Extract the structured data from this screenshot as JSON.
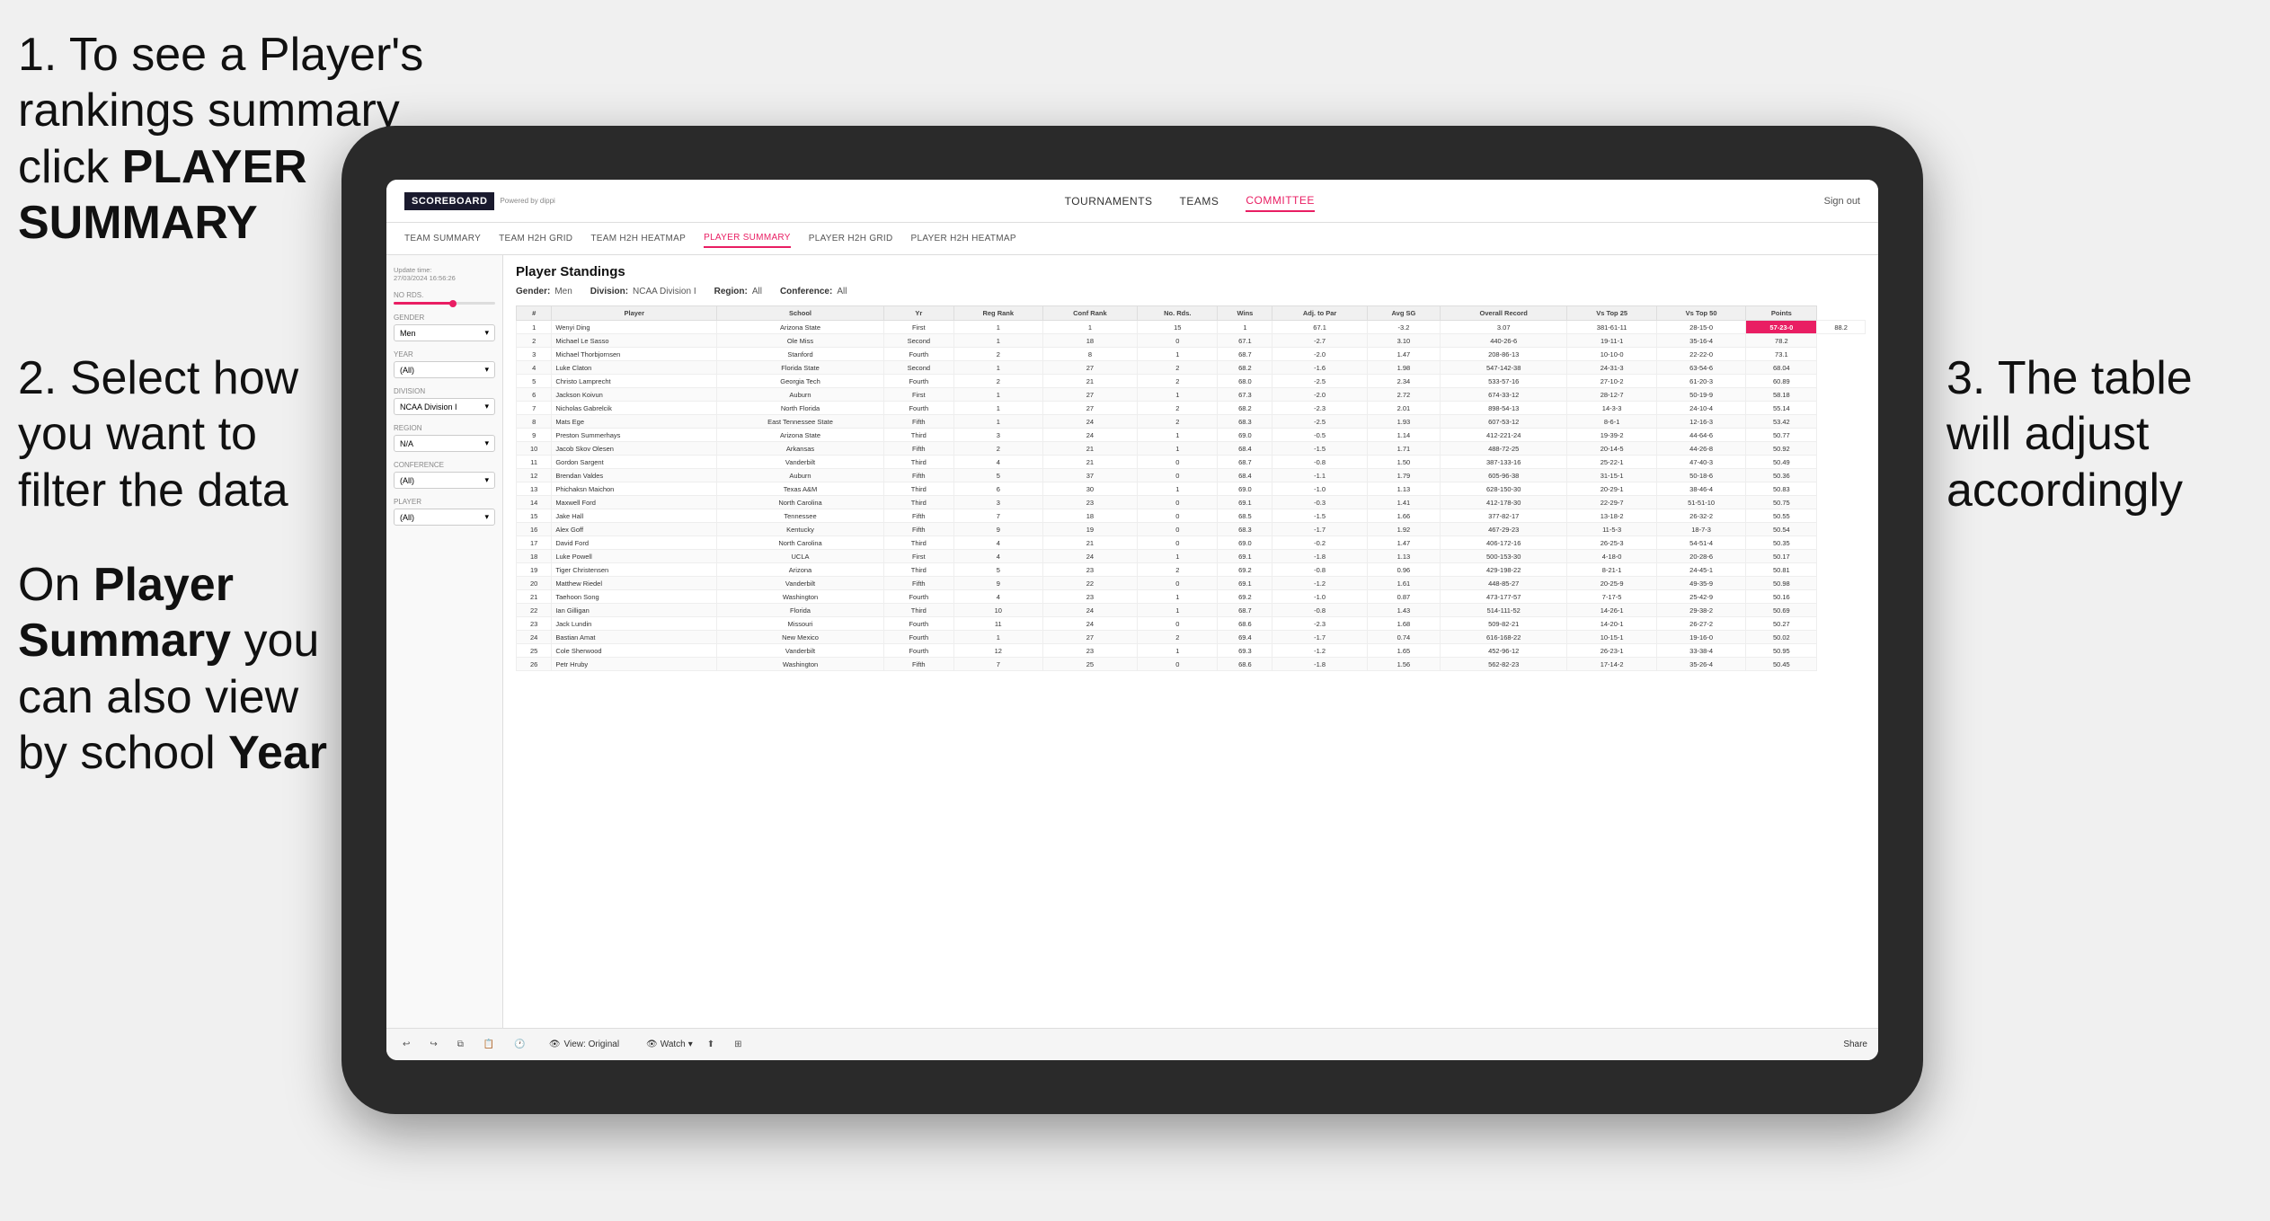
{
  "instructions": {
    "step1": "1. To see a Player's rankings summary click ",
    "step1_bold": "PLAYER SUMMARY",
    "step2_title": "2. Select how you want to filter the data",
    "step3_title": "3. The table will adjust accordingly",
    "bottom_note": "On ",
    "bottom_bold1": "Player Summary",
    "bottom_mid": " you can also view by school ",
    "bottom_bold2": "Year"
  },
  "app": {
    "logo": "SCOREBOARD",
    "logo_sub": "Powered by dippi",
    "sign_out": "Sign out"
  },
  "nav": {
    "items": [
      "TOURNAMENTS",
      "TEAMS",
      "COMMITTEE"
    ],
    "active": "COMMITTEE"
  },
  "subnav": {
    "items": [
      "TEAM SUMMARY",
      "TEAM H2H GRID",
      "TEAM H2H HEATMAP",
      "PLAYER SUMMARY",
      "PLAYER H2H GRID",
      "PLAYER H2H HEATMAP"
    ],
    "active": "PLAYER SUMMARY"
  },
  "sidebar": {
    "update_label": "Update time:",
    "update_time": "27/03/2024 16:56:26",
    "no_rds_label": "No Rds.",
    "gender_label": "Gender",
    "gender_value": "Men",
    "year_label": "Year",
    "year_value": "(All)",
    "division_label": "Division",
    "division_value": "NCAA Division I",
    "region_label": "Region",
    "region_value": "N/A",
    "conference_label": "Conference",
    "conference_value": "(All)",
    "player_label": "Player",
    "player_value": "(All)"
  },
  "table": {
    "title": "Player Standings",
    "gender": "Men",
    "division": "NCAA Division I",
    "region": "All",
    "conference": "All",
    "columns": [
      "#",
      "Player",
      "School",
      "Yr",
      "Reg Rank",
      "Conf Rank",
      "No. Rds.",
      "Wins",
      "Adj. to Par",
      "Avg SG",
      "Overall Record",
      "Vs Top 25",
      "Vs Top 50",
      "Points"
    ],
    "rows": [
      [
        "1",
        "Wenyi Ding",
        "Arizona State",
        "First",
        "1",
        "1",
        "15",
        "1",
        "67.1",
        "-3.2",
        "3.07",
        "381-61-11",
        "28-15-0",
        "57-23-0",
        "88.2"
      ],
      [
        "2",
        "Michael Le Sasso",
        "Ole Miss",
        "Second",
        "1",
        "18",
        "0",
        "67.1",
        "-2.7",
        "3.10",
        "440-26-6",
        "19-11-1",
        "35-16-4",
        "78.2"
      ],
      [
        "3",
        "Michael Thorbjornsen",
        "Stanford",
        "Fourth",
        "2",
        "8",
        "1",
        "68.7",
        "-2.0",
        "1.47",
        "208-86-13",
        "10-10-0",
        "22-22-0",
        "73.1"
      ],
      [
        "4",
        "Luke Claton",
        "Florida State",
        "Second",
        "1",
        "27",
        "2",
        "68.2",
        "-1.6",
        "1.98",
        "547-142-38",
        "24-31-3",
        "63-54-6",
        "68.04"
      ],
      [
        "5",
        "Christo Lamprecht",
        "Georgia Tech",
        "Fourth",
        "2",
        "21",
        "2",
        "68.0",
        "-2.5",
        "2.34",
        "533-57-16",
        "27-10-2",
        "61-20-3",
        "60.89"
      ],
      [
        "6",
        "Jackson Koivun",
        "Auburn",
        "First",
        "1",
        "27",
        "1",
        "67.3",
        "-2.0",
        "2.72",
        "674-33-12",
        "28-12-7",
        "50-19-9",
        "58.18"
      ],
      [
        "7",
        "Nicholas Gabrelcik",
        "North Florida",
        "Fourth",
        "1",
        "27",
        "2",
        "68.2",
        "-2.3",
        "2.01",
        "898-54-13",
        "14-3-3",
        "24-10-4",
        "55.14"
      ],
      [
        "8",
        "Mats Ege",
        "East Tennessee State",
        "Fifth",
        "1",
        "24",
        "2",
        "68.3",
        "-2.5",
        "1.93",
        "607-53-12",
        "8-6-1",
        "12-16-3",
        "53.42"
      ],
      [
        "9",
        "Preston Summerhays",
        "Arizona State",
        "Third",
        "3",
        "24",
        "1",
        "69.0",
        "-0.5",
        "1.14",
        "412-221-24",
        "19-39-2",
        "44-64-6",
        "50.77"
      ],
      [
        "10",
        "Jacob Skov Olesen",
        "Arkansas",
        "Fifth",
        "2",
        "21",
        "1",
        "68.4",
        "-1.5",
        "1.71",
        "488-72-25",
        "20-14-5",
        "44-26-8",
        "50.92"
      ],
      [
        "11",
        "Gordon Sargent",
        "Vanderbilt",
        "Third",
        "4",
        "21",
        "0",
        "68.7",
        "-0.8",
        "1.50",
        "387-133-16",
        "25-22-1",
        "47-40-3",
        "50.49"
      ],
      [
        "12",
        "Brendan Valdes",
        "Auburn",
        "Fifth",
        "5",
        "37",
        "0",
        "68.4",
        "-1.1",
        "1.79",
        "605-96-38",
        "31-15-1",
        "50-18-6",
        "50.36"
      ],
      [
        "13",
        "Phichaksn Maichon",
        "Texas A&M",
        "Third",
        "6",
        "30",
        "1",
        "69.0",
        "-1.0",
        "1.13",
        "628-150-30",
        "20-29-1",
        "38-46-4",
        "50.83"
      ],
      [
        "14",
        "Maxwell Ford",
        "North Carolina",
        "Third",
        "3",
        "23",
        "0",
        "69.1",
        "-0.3",
        "1.41",
        "412-178-30",
        "22-29-7",
        "51-51-10",
        "50.75"
      ],
      [
        "15",
        "Jake Hall",
        "Tennessee",
        "Fifth",
        "7",
        "18",
        "0",
        "68.5",
        "-1.5",
        "1.66",
        "377-82-17",
        "13-18-2",
        "26-32-2",
        "50.55"
      ],
      [
        "16",
        "Alex Goff",
        "Kentucky",
        "Fifth",
        "9",
        "19",
        "0",
        "68.3",
        "-1.7",
        "1.92",
        "467-29-23",
        "11-5-3",
        "18-7-3",
        "50.54"
      ],
      [
        "17",
        "David Ford",
        "North Carolina",
        "Third",
        "4",
        "21",
        "0",
        "69.0",
        "-0.2",
        "1.47",
        "406-172-16",
        "26-25-3",
        "54-51-4",
        "50.35"
      ],
      [
        "18",
        "Luke Powell",
        "UCLA",
        "First",
        "4",
        "24",
        "1",
        "69.1",
        "-1.8",
        "1.13",
        "500-153-30",
        "4-18-0",
        "20-28-6",
        "50.17"
      ],
      [
        "19",
        "Tiger Christensen",
        "Arizona",
        "Third",
        "5",
        "23",
        "2",
        "69.2",
        "-0.8",
        "0.96",
        "429-198-22",
        "8-21-1",
        "24-45-1",
        "50.81"
      ],
      [
        "20",
        "Matthew Riedel",
        "Vanderbilt",
        "Fifth",
        "9",
        "22",
        "0",
        "69.1",
        "-1.2",
        "1.61",
        "448-85-27",
        "20-25-9",
        "49-35-9",
        "50.98"
      ],
      [
        "21",
        "Taehoon Song",
        "Washington",
        "Fourth",
        "4",
        "23",
        "1",
        "69.2",
        "-1.0",
        "0.87",
        "473-177-57",
        "7-17-5",
        "25-42-9",
        "50.16"
      ],
      [
        "22",
        "Ian Gilligan",
        "Florida",
        "Third",
        "10",
        "24",
        "1",
        "68.7",
        "-0.8",
        "1.43",
        "514-111-52",
        "14-26-1",
        "29-38-2",
        "50.69"
      ],
      [
        "23",
        "Jack Lundin",
        "Missouri",
        "Fourth",
        "11",
        "24",
        "0",
        "68.6",
        "-2.3",
        "1.68",
        "509-82-21",
        "14-20-1",
        "26-27-2",
        "50.27"
      ],
      [
        "24",
        "Bastian Amat",
        "New Mexico",
        "Fourth",
        "1",
        "27",
        "2",
        "69.4",
        "-1.7",
        "0.74",
        "616-168-22",
        "10-15-1",
        "19-16-0",
        "50.02"
      ],
      [
        "25",
        "Cole Sherwood",
        "Vanderbilt",
        "Fourth",
        "12",
        "23",
        "1",
        "69.3",
        "-1.2",
        "1.65",
        "452-96-12",
        "26-23-1",
        "33-38-4",
        "50.95"
      ],
      [
        "26",
        "Petr Hruby",
        "Washington",
        "Fifth",
        "7",
        "25",
        "0",
        "68.6",
        "-1.8",
        "1.56",
        "562-82-23",
        "17-14-2",
        "35-26-4",
        "50.45"
      ]
    ]
  },
  "toolbar": {
    "view_original": "View: Original",
    "watch": "Watch",
    "share": "Share"
  }
}
